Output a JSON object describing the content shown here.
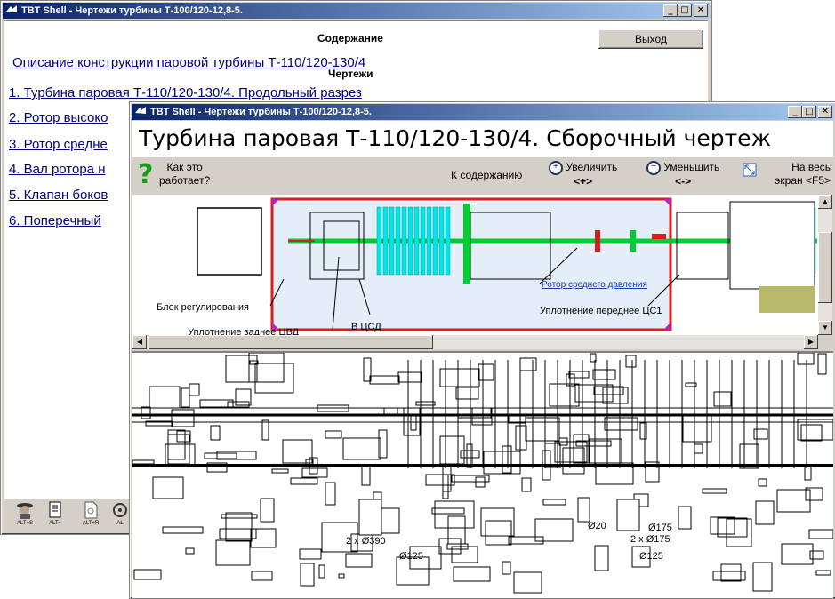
{
  "back_window": {
    "title": "TBT Shell - Чертежи турбины Т-100/120-12,8-5.",
    "contents_heading": "Содержание",
    "exit_label": "Выход",
    "description_link": "Описание конструкции паровой турбины Т-110/120-130/4",
    "drawings_heading": "Чертежи",
    "links": [
      "1. Турбина паровая Т-110/120-130/4. Продольный разрез",
      "2. Ротор высоко",
      "3. Ротор средне",
      "4. Вал ротора н",
      "5. Клапан боков",
      "6. Поперечный"
    ],
    "bottom_icons": [
      {
        "icon": "user-hat-icon",
        "label": "ALT+S"
      },
      {
        "icon": "document-icon",
        "label": "ALT+"
      },
      {
        "icon": "page-icon",
        "label": "ALT+R"
      },
      {
        "icon": "gear-icon",
        "label": "AL"
      }
    ]
  },
  "front_window": {
    "title": "TBT Shell - Чертежи турбины Т-100/120-12,8-5.",
    "heading": "Турбина паровая Т-110/120-130/4. Сборочный чертеж",
    "toolbar": {
      "how_line1": "Как это",
      "how_line2": "работает?",
      "to_contents": "К содержанию",
      "zoom_in": "Увеличить",
      "zoom_in_key": "<+>",
      "zoom_out": "Уменьшить",
      "zoom_out_key": "<->",
      "fullscreen": "На весь",
      "fullscreen_line2": "экран <F5>"
    },
    "diagram_labels": {
      "control_block": "Блок регулирования",
      "rear_seal": "Уплотнение заднее ЦВД",
      "to_csd": "В ЦСД",
      "rotor_link": "Ротор среднего давления",
      "front_seal": "Уплотнение переднее ЦС1"
    },
    "drawing_marks": [
      "Ø125",
      "2 x Ø390",
      "Ø20",
      "Ø175",
      "2 x Ø175",
      "Ø125"
    ]
  },
  "colors": {
    "title_active": "#0a246a",
    "shaft": "#00cc33",
    "blades": "#00e5e5",
    "frame": "#d81f1f",
    "selection_fill": "#e3eef9"
  }
}
